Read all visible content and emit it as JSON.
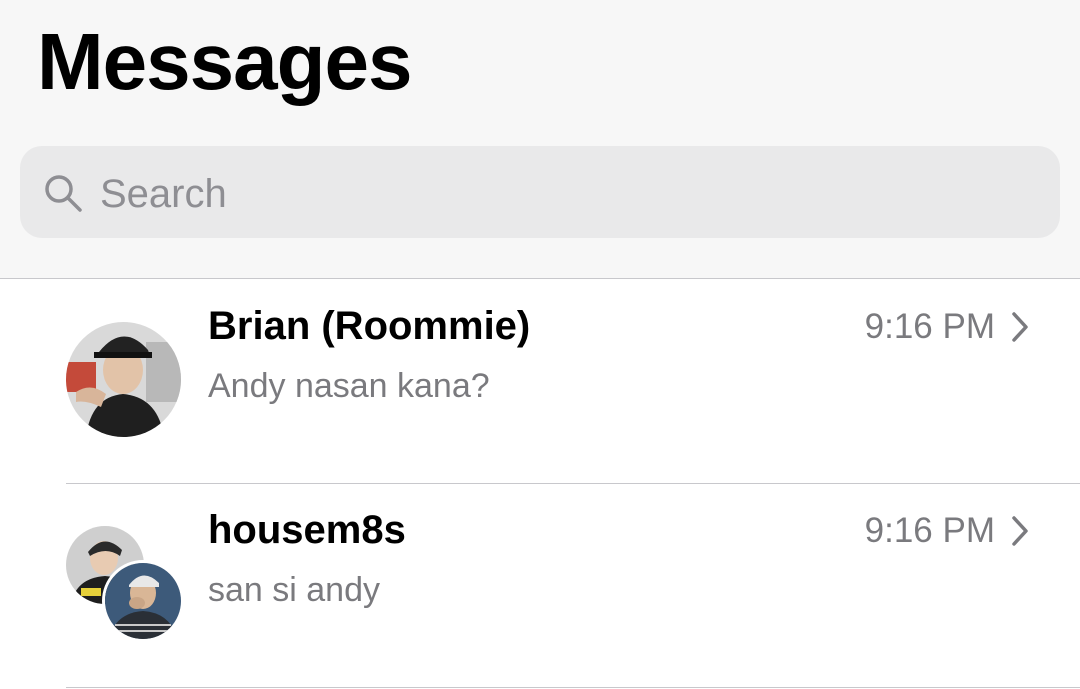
{
  "header": {
    "title": "Messages"
  },
  "search": {
    "placeholder": "Search",
    "icon": "search-icon"
  },
  "conversations": [
    {
      "name": "Brian (Roommie)",
      "preview": "Andy nasan kana?",
      "time": "9:16 PM",
      "avatar": "single-contact-photo"
    },
    {
      "name": "housem8s",
      "preview": "san si andy",
      "time": "9:16 PM",
      "avatar": "group-contact-photos"
    }
  ],
  "colors": {
    "header_bg": "#f7f7f7",
    "search_bg": "#e9e9ea",
    "secondary_text": "#7a7a7e",
    "separator": "#c8c8cc"
  }
}
